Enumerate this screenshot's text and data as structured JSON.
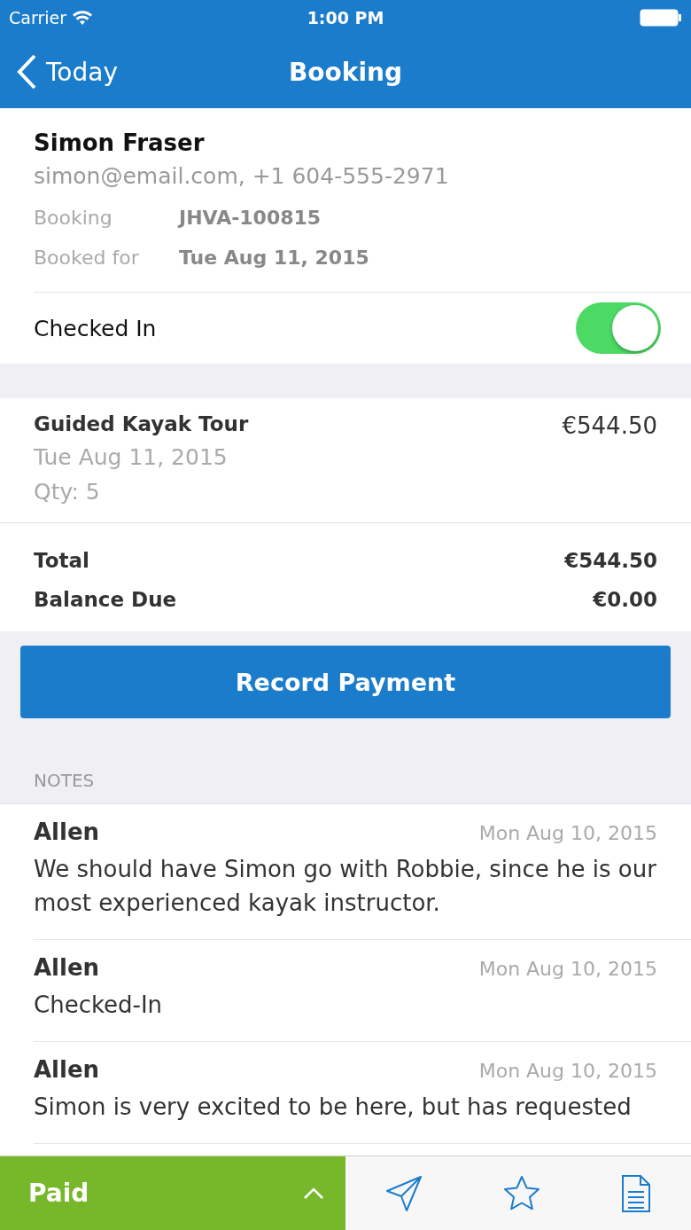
{
  "status_bar": {
    "carrier": "Carrier",
    "time": "1:00 PM"
  },
  "nav": {
    "back": "Today",
    "title": "Booking"
  },
  "customer": {
    "name": "Simon Fraser",
    "contact": "simon@email.com, +1 604-555-2971",
    "fields": [
      {
        "label": "Booking",
        "value": "JHVA-100815"
      },
      {
        "label": "Booked for",
        "value": "Tue Aug 11, 2015"
      }
    ],
    "checked_in": {
      "label": "Checked In",
      "on": true
    }
  },
  "item": {
    "name": "Guided Kayak Tour",
    "date": "Tue Aug 11, 2015",
    "qty": "Qty: 5",
    "price": "€544.50"
  },
  "totals": [
    {
      "label": "Total",
      "value": "€544.50"
    },
    {
      "label": "Balance Due",
      "value": "€0.00"
    }
  ],
  "record_button": "Record Payment",
  "notes_header": "NOTES",
  "notes": [
    {
      "author": "Allen",
      "date": "Mon Aug 10, 2015",
      "text": "We should have Simon go with Robbie, since he is our most experienced kayak instructor."
    },
    {
      "author": "Allen",
      "date": "Mon Aug 10, 2015",
      "text": "Checked-In"
    },
    {
      "author": "Allen",
      "date": "Mon Aug 10, 2015",
      "text": "Simon is very excited to be here, but has requested"
    }
  ],
  "bottom_bar": {
    "status": "Paid"
  }
}
